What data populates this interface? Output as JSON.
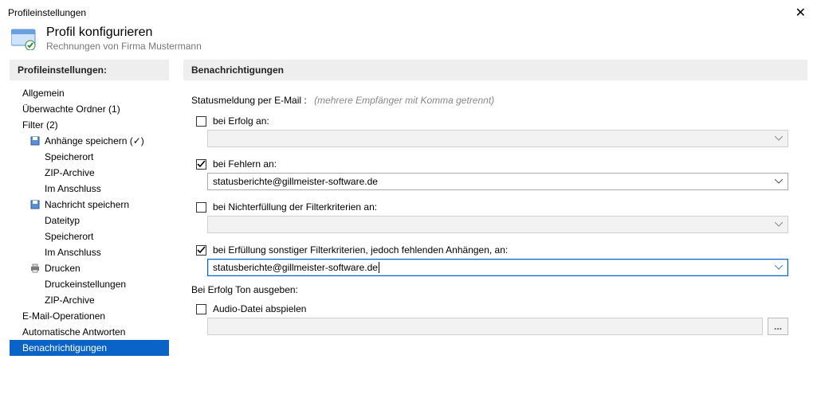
{
  "window": {
    "title": "Profileinstellungen"
  },
  "header": {
    "title": "Profil konfigurieren",
    "subtitle": "Rechnungen von Firma Mustermann"
  },
  "sidebar": {
    "heading": "Profileinstellungen:",
    "items": [
      {
        "label": "Allgemein",
        "level": 0
      },
      {
        "label": "Überwachte Ordner (1)",
        "level": 0
      },
      {
        "label": "Filter (2)",
        "level": 0
      },
      {
        "label": "Anhänge speichern (✓)",
        "level": 1,
        "icon": "save-icon"
      },
      {
        "label": "Speicherort",
        "level": 2
      },
      {
        "label": "ZIP-Archive",
        "level": 2
      },
      {
        "label": "Im Anschluss",
        "level": 2
      },
      {
        "label": "Nachricht speichern",
        "level": 1,
        "icon": "save-icon"
      },
      {
        "label": "Dateityp",
        "level": 2
      },
      {
        "label": "Speicherort",
        "level": 2
      },
      {
        "label": "Im Anschluss",
        "level": 2
      },
      {
        "label": "Drucken",
        "level": 1,
        "icon": "print-icon"
      },
      {
        "label": "Druckeinstellungen",
        "level": 2
      },
      {
        "label": "ZIP-Archive",
        "level": 2
      },
      {
        "label": "E-Mail-Operationen",
        "level": 0
      },
      {
        "label": "Automatische Antworten",
        "level": 0
      },
      {
        "label": "Benachrichtigungen",
        "level": 0,
        "selected": true
      }
    ]
  },
  "main": {
    "heading": "Benachrichtigungen",
    "status_label": "Statusmeldung per E-Mail :",
    "status_hint": "(mehrere Empfänger mit Komma getrennt)",
    "fields": {
      "success": {
        "label": "bei Erfolg an:",
        "checked": false,
        "value": ""
      },
      "error": {
        "label": "bei Fehlern an:",
        "checked": true,
        "value": "statusberichte@gillmeister-software.de"
      },
      "nofilter": {
        "label": "bei Nichterfüllung der Filterkriterien an:",
        "checked": false,
        "value": ""
      },
      "otherfilter": {
        "label": "bei Erfüllung sonstiger Filterkriterien, jedoch fehlenden Anhängen, an:",
        "checked": true,
        "value": "statusberichte@gillmeister-software.de"
      }
    },
    "sound": {
      "heading": "Bei Erfolg Ton ausgeben:",
      "checkbox_label": "Audio-Datei abspielen",
      "checked": false,
      "file": "",
      "browse_label": "..."
    }
  }
}
